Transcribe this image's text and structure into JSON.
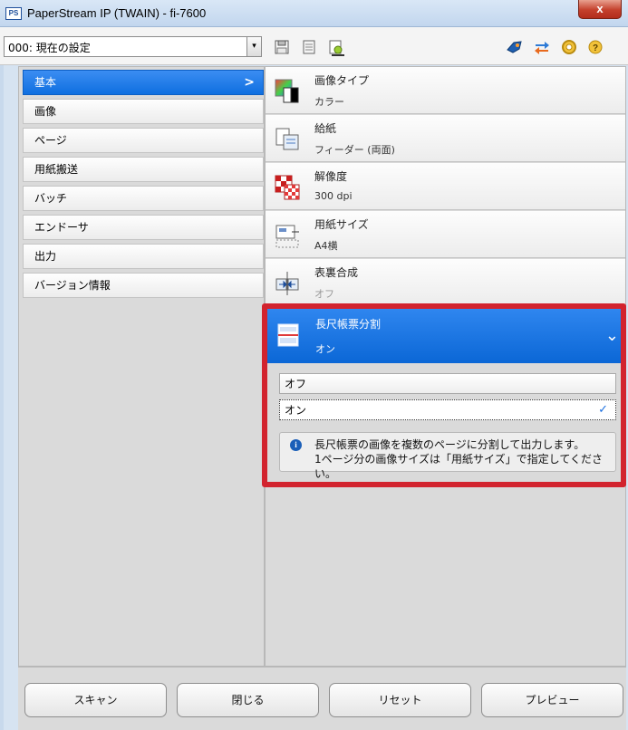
{
  "window": {
    "icon_text": "PS",
    "title": "PaperStream IP (TWAIN) - fi-7600",
    "close_glyph": "x"
  },
  "toolbar": {
    "profile_value": "000: 現在の設定",
    "profile_arrow_glyph": "▾",
    "icons": [
      "save-icon",
      "delete-icon",
      "edit-profile-icon",
      "quick-icon",
      "swap-icon",
      "settings-icon",
      "help-icon"
    ]
  },
  "nav": {
    "items": [
      {
        "label": "基本",
        "selected": true
      },
      {
        "label": "画像"
      },
      {
        "label": "ページ"
      },
      {
        "label": "用紙搬送"
      },
      {
        "label": "バッチ"
      },
      {
        "label": "エンドーサ"
      },
      {
        "label": "出力"
      },
      {
        "label": "バージョン情報"
      }
    ],
    "selected_arrow": ">"
  },
  "settings": [
    {
      "title": "画像タイプ",
      "value": "カラー",
      "icon": "image-type-icon"
    },
    {
      "title": "給紙",
      "value": "フィーダー (両面)",
      "icon": "paper-source-icon"
    },
    {
      "title": "解像度",
      "value": "300 dpi",
      "icon": "resolution-icon"
    },
    {
      "title": "用紙サイズ",
      "value": "A4横",
      "icon": "paper-size-icon"
    },
    {
      "title": "表裏合成",
      "value": "オフ",
      "icon": "merge-icon"
    }
  ],
  "expanded": {
    "title": "長尺帳票分割",
    "value": "オン",
    "chevron": "⌄",
    "options": [
      {
        "label": "オフ",
        "selected": false
      },
      {
        "label": "オン",
        "selected": true
      }
    ],
    "check_glyph": "✓",
    "info_icon_glyph": "i",
    "info_line1": "長尺帳票の画像を複数のページに分割して出力します。",
    "info_line2": "1ページ分の画像サイズは「用紙サイズ」で指定してください。"
  },
  "buttons": {
    "scan": "スキャン",
    "close": "閉じる",
    "reset": "リセット",
    "preview": "プレビュー"
  },
  "colors": {
    "selected_blue": "#0f6fe0",
    "highlight_red": "#d2232e",
    "check_blue": "#1a6fe0"
  }
}
